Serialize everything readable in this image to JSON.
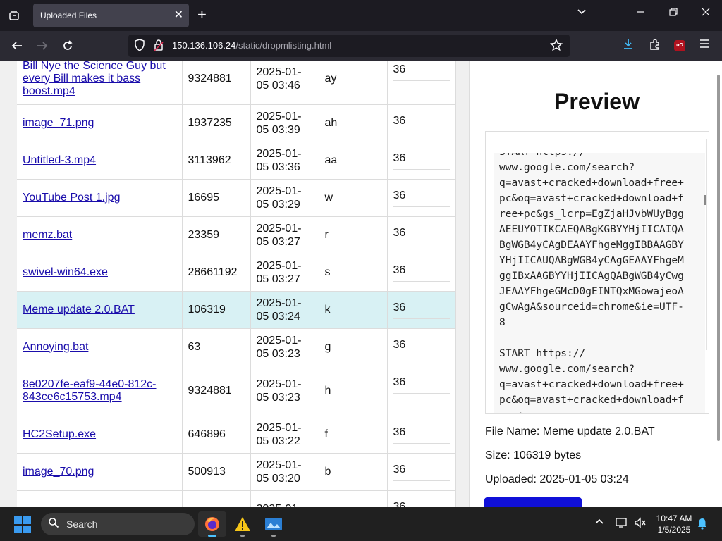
{
  "browser": {
    "tab_title": "Uploaded Files",
    "tab_close": "✕",
    "new_tab": "+",
    "url_host": "150.136.106.24",
    "url_path": "/static/dropmlisting.html",
    "icons": [
      "tab-list-icon",
      "back-icon",
      "forward-icon",
      "reload-icon",
      "shield-icon",
      "lock-icon",
      "star-icon",
      "download-icon",
      "extensions-icon",
      "ublock-icon",
      "menu-icon"
    ],
    "window_controls": [
      "chevron-down-icon",
      "minimize-icon",
      "restore-icon",
      "close-icon"
    ]
  },
  "files": [
    {
      "name": "Bill Nye the Science Guy but every Bill makes it bass boost.mp4",
      "size": "9324881",
      "date": "2025-01-05 03:46",
      "code": "ay",
      "num": "36",
      "selected": false
    },
    {
      "name": "image_71.png",
      "size": "1937235",
      "date": "2025-01-05 03:39",
      "code": "ah",
      "num": "36",
      "selected": false
    },
    {
      "name": "Untitled-3.mp4",
      "size": "3113962",
      "date": "2025-01-05 03:36",
      "code": "aa",
      "num": "36",
      "selected": false
    },
    {
      "name": "YouTube Post 1.jpg",
      "size": "16695",
      "date": "2025-01-05 03:29",
      "code": "w",
      "num": "36",
      "selected": false
    },
    {
      "name": "memz.bat",
      "size": "23359",
      "date": "2025-01-05 03:27",
      "code": "r",
      "num": "36",
      "selected": false
    },
    {
      "name": "swivel-win64.exe",
      "size": "28661192",
      "date": "2025-01-05 03:27",
      "code": "s",
      "num": "36",
      "selected": false
    },
    {
      "name": "Meme update 2.0.BAT",
      "size": "106319",
      "date": "2025-01-05 03:24",
      "code": "k",
      "num": "36",
      "selected": true
    },
    {
      "name": "Annoying.bat",
      "size": "63",
      "date": "2025-01-05 03:23",
      "code": "g",
      "num": "36",
      "selected": false
    },
    {
      "name": "8e0207fe-eaf9-44e0-812c-843ce6c15753.mp4",
      "size": "9324881",
      "date": "2025-01-05 03:23",
      "code": "h",
      "num": "36",
      "selected": false
    },
    {
      "name": "HC2Setup.exe",
      "size": "646896",
      "date": "2025-01-05 03:22",
      "code": "f",
      "num": "36",
      "selected": false
    },
    {
      "name": "image_70.png",
      "size": "500913",
      "date": "2025-01-05 03:20",
      "code": "b",
      "num": "36",
      "selected": false
    },
    {
      "name": "",
      "size": "",
      "date": "2025-01-",
      "code": "",
      "num": "36",
      "selected": false
    }
  ],
  "preview": {
    "title": "Preview",
    "code": "START https://\nwww.google.com/search?\nq=avast+cracked+download+free+pc&oq=avast+cracked+download+free+pc&gs_lcrp=EgZjaHJvbWUyBggAEEUYOTIKCAEQABgKGBYYHjIICAIQABgWGB4yCAgDEAAYFhgeMggIBBAAGBYYHjIICAUQABgWGB4yCAgGEAAYFhgeMggIBxAAGBYYHjIICAgQABgWGB4yCwgJEAAYFhgeGMcD0gEINTQxMGowajeoAgCwAgA&sourceid=chrome&ie=UTF-8\n\nSTART https://\nwww.google.com/search?\nq=avast+cracked+download+free+pc&oq=avast+cracked+download+free+pc",
    "file_name": "File Name: Meme update 2.0.BAT",
    "size": "Size: 106319 bytes",
    "uploaded": "Uploaded: 2025-01-05 03:24"
  },
  "taskbar": {
    "search_label": "Search",
    "time": "10:47 AM",
    "date": "1/5/2025",
    "apps": [
      "firefox-icon",
      "warning-icon",
      "image-viewer-icon"
    ]
  }
}
